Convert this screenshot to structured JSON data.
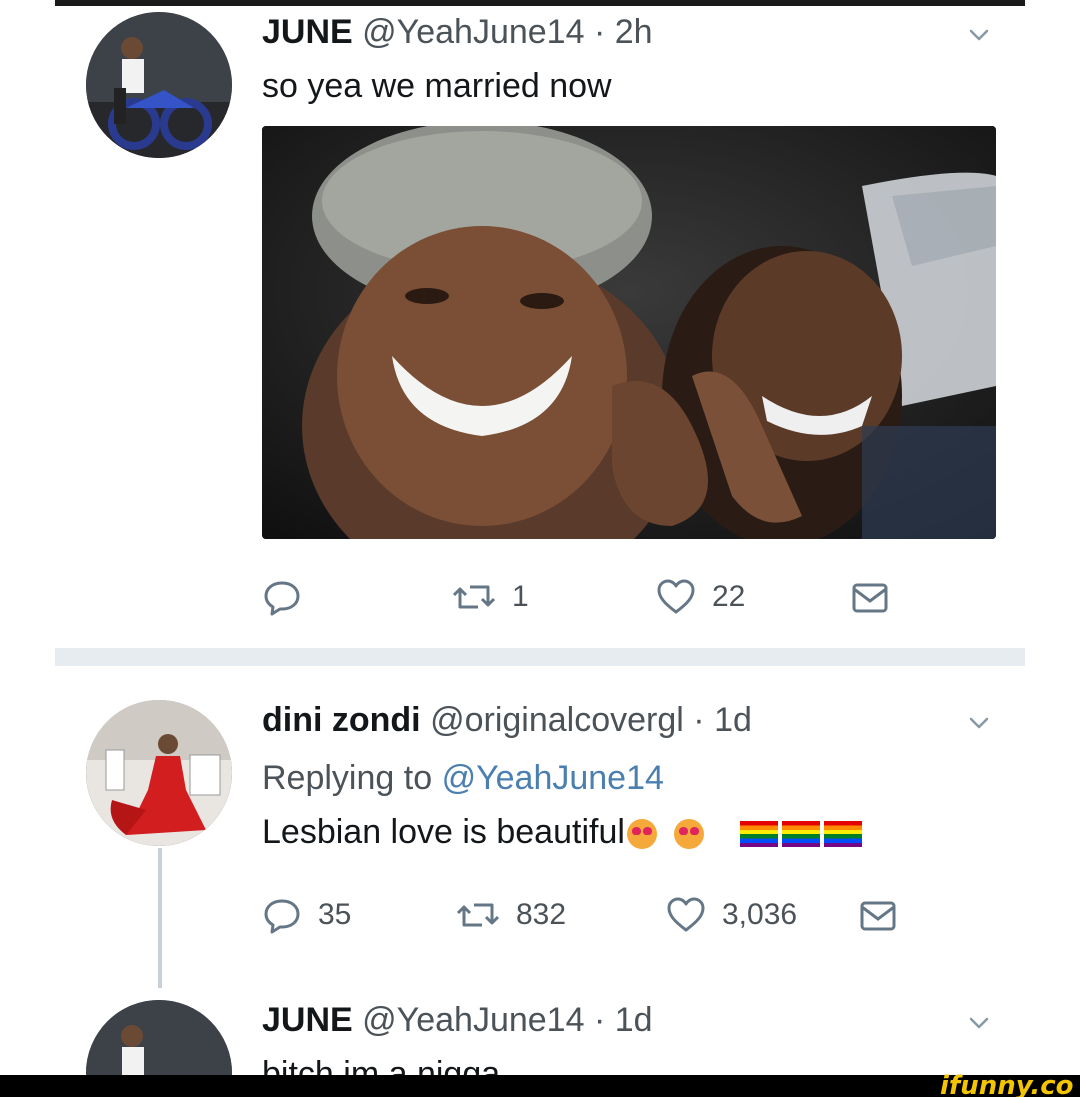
{
  "tweets": [
    {
      "name": "JUNE",
      "handle": "@YeahJune14",
      "time": "· 2h",
      "text": "so yea we married now",
      "actions": {
        "reply_count": "",
        "retweet_count": "1",
        "like_count": "22"
      }
    },
    {
      "name": "dini zondi",
      "handle": "@originalcovergl",
      "time": "· 1d",
      "replying_prefix": "Replying to",
      "replying_to": "@YeahJune14",
      "text": "Lesbian love is beautiful",
      "actions": {
        "reply_count": "35",
        "retweet_count": "832",
        "like_count": "3,036"
      }
    },
    {
      "name": "JUNE",
      "handle": "@YeahJune14",
      "time": "· 1d",
      "text": "bitch im a nigga"
    }
  ],
  "watermark": "ifunny.co",
  "colors": {
    "icon": "#657786",
    "divider": "#e6ecf0",
    "mention": "#4a7fb0",
    "watermark": "#f2c500"
  },
  "icons": [
    "reply-icon",
    "retweet-icon",
    "like-icon",
    "message-icon",
    "chevron-down-icon"
  ]
}
